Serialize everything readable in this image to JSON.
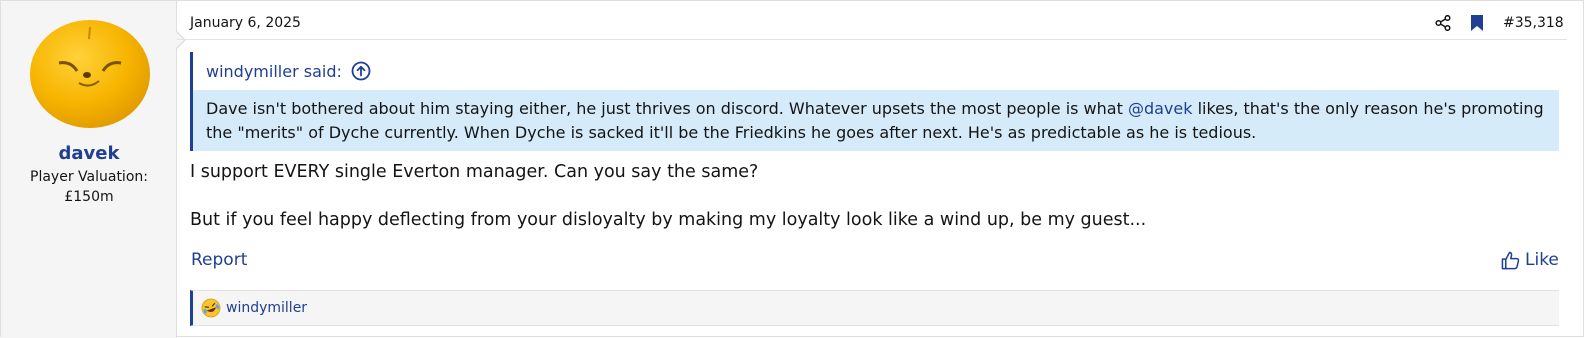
{
  "user": {
    "name": "davek",
    "title_line1": "Player Valuation:",
    "title_line2": "£150m",
    "avatar_icon": "orange-face-avatar"
  },
  "post": {
    "date": "January 6, 2025",
    "number": "#35,318",
    "share_icon": "share-icon",
    "bookmark_icon": "bookmark-icon"
  },
  "quote": {
    "author": "windymiller said:",
    "text_before_mention": "Dave isn't bothered about him staying either, he just thrives on discord. Whatever upsets the most people is what ",
    "mention": "@davek",
    "text_after_mention": " likes, that's the only reason he's promoting the \"merits\" of Dyche currently. When Dyche is sacked it'll be the Friedkins he goes after next. He's as predictable as he is tedious."
  },
  "message": {
    "line1": "I support EVERY single Everton manager. Can you say the same?",
    "line2": "But if you feel happy deflecting from your disloyalty by making my loyalty look like a wind up, be my guest..."
  },
  "actions": {
    "report_label": "Report",
    "like_label": "Like"
  },
  "reactions": {
    "icon": "laughing-emoji-icon",
    "users": "windymiller"
  },
  "colors": {
    "link": "#1f3f93",
    "quote_bg": "#d6ebfa",
    "sidebar_bg": "#f5f5f5"
  }
}
